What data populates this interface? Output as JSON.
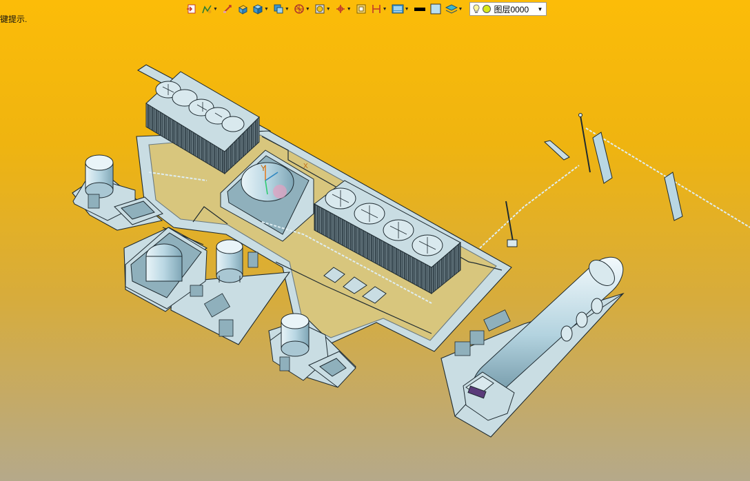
{
  "status": {
    "hint": "键提示."
  },
  "toolbar": {
    "items": [
      {
        "icon": "exit-sketch-icon",
        "dropdown": false
      },
      {
        "icon": "sketch-icon",
        "dropdown": true
      },
      {
        "icon": "smart-dimension-icon",
        "dropdown": false
      },
      {
        "icon": "extrude-boss-icon",
        "dropdown": false
      },
      {
        "icon": "view-orientation-icon",
        "dropdown": true
      },
      {
        "icon": "display-style-icon",
        "dropdown": true
      },
      {
        "icon": "section-view-icon",
        "dropdown": true
      },
      {
        "icon": "hide-show-items-icon",
        "dropdown": true
      },
      {
        "icon": "reference-triad-icon",
        "dropdown": true
      },
      {
        "icon": "zoom-to-fit-icon",
        "dropdown": false
      },
      {
        "icon": "dimension-chain-icon",
        "dropdown": true
      },
      {
        "icon": "apply-scene-icon",
        "dropdown": true
      },
      {
        "icon": "line-color-icon",
        "dropdown": false
      },
      {
        "icon": "face-color-icon",
        "dropdown": false
      },
      {
        "icon": "layer-properties-icon",
        "dropdown": true
      }
    ],
    "layer": {
      "name": "图层0000",
      "bulb_color": "#fff59a",
      "dot_color": "#d6e81c"
    }
  },
  "colors": {
    "model_fill": "#c9dde3",
    "model_dark": "#8fb0bc",
    "edge": "#1e2a30",
    "tank": "#b9d7e3"
  },
  "triad": {
    "y_label": "Y",
    "x_label": "X"
  }
}
